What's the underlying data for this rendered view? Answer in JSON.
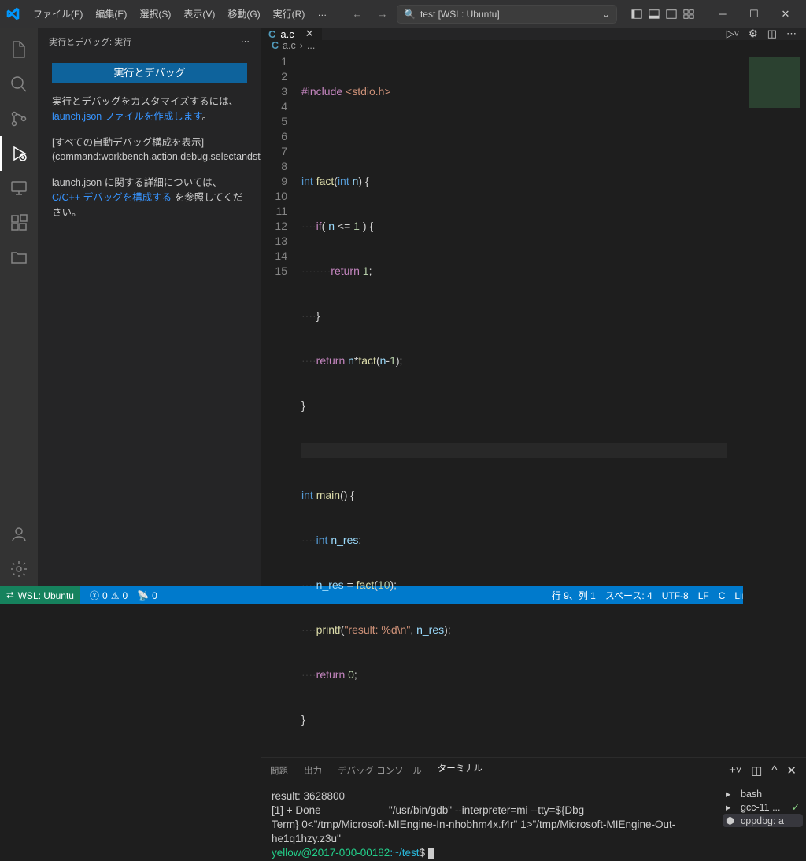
{
  "menu": {
    "file": "ファイル(F)",
    "edit": "編集(E)",
    "select": "選択(S)",
    "view": "表示(V)",
    "go": "移動(G)",
    "run": "実行(R)",
    "more": "…"
  },
  "search": {
    "icon": "🔍",
    "text": "test [WSL: Ubuntu]"
  },
  "sidebar": {
    "title": "実行とデバッグ: 実行",
    "runBtn": "実行とデバッグ",
    "p1a": "実行とデバッグをカスタマイズするには、",
    "p1link": "launch.json ファイルを作成します",
    "p1b": "。",
    "p2": "[すべての自動デバッグ構成を表示](command:workbench.action.debug.selectandstart)。",
    "p3a": "launch.json に関する詳細については、",
    "p3link": "C/C++ デバッグを構成する",
    "p3b": " を参照してください。"
  },
  "tab": {
    "name": "a.c"
  },
  "breadcrumb": {
    "file": "a.c",
    "sep": "›",
    "more": "..."
  },
  "code": {
    "1": {
      "pre": "#include",
      "rest": " <stdio.h>"
    },
    "2": "",
    "3": {
      "a": "int ",
      "b": "fact",
      "c": "(",
      "d": "int ",
      "e": "n",
      "f": ") {"
    },
    "4": {
      "ws": "····",
      "a": "if",
      "b": "( ",
      "c": "n",
      "d": " <= ",
      "e": "1",
      "f": " ) {"
    },
    "5": {
      "ws": "········",
      "a": "return ",
      "b": "1",
      "c": ";"
    },
    "6": {
      "ws": "····",
      "a": "}"
    },
    "7": {
      "ws": "····",
      "a": "return ",
      "b": "n",
      "c": "*",
      "d": "fact",
      "e": "(",
      "f": "n",
      "g": "-",
      "h": "1",
      "i": ");"
    },
    "8": {
      "a": "}"
    },
    "9": "",
    "10": {
      "a": "int ",
      "b": "main",
      "c": "() {"
    },
    "11": {
      "ws": "····",
      "a": "int ",
      "b": "n_res",
      "c": ";"
    },
    "12": {
      "ws": "····",
      "a": "n_res",
      "b": " = ",
      "c": "fact",
      "d": "(",
      "e": "10",
      "f": ");"
    },
    "13": {
      "ws": "····",
      "a": "printf",
      "b": "(",
      "c": "\"result: %d\\n\"",
      "d": ", ",
      "e": "n_res",
      "f": ");"
    },
    "14": {
      "ws": "····",
      "a": "return ",
      "b": "0",
      "c": ";"
    },
    "15": {
      "a": "}"
    }
  },
  "lineNums": [
    "1",
    "2",
    "3",
    "4",
    "5",
    "6",
    "7",
    "8",
    "9",
    "10",
    "11",
    "12",
    "13",
    "14",
    "15"
  ],
  "panel": {
    "t1": "問題",
    "t2": "出力",
    "t3": "デバッグ コンソール",
    "t4": "ターミナル"
  },
  "terminal": {
    "l1": "result: 3628800",
    "l2": "[1] + Done                       \"/usr/bin/gdb\" --interpreter=mi --tty=${Dbg",
    "l3": "Term} 0<\"/tmp/Microsoft-MIEngine-In-nhobhm4x.f4r\" 1>\"/tmp/Microsoft-MIEngine-Out-he1q1hzy.z3u\"",
    "user": "yellow@2017-000-00182",
    "path": ":~/test",
    "prompt": "$ "
  },
  "termList": {
    "t1": "bash",
    "t2": "gcc-11 ...",
    "t3": "cppdbg: a"
  },
  "status": {
    "remote": "WSL: Ubuntu",
    "err": "0",
    "warn": "0",
    "ports": "0",
    "cursor": "行 9、列 1",
    "spaces": "スペース: 4",
    "enc": "UTF-8",
    "eol": "LF",
    "lang": "C",
    "os": "Linux"
  }
}
